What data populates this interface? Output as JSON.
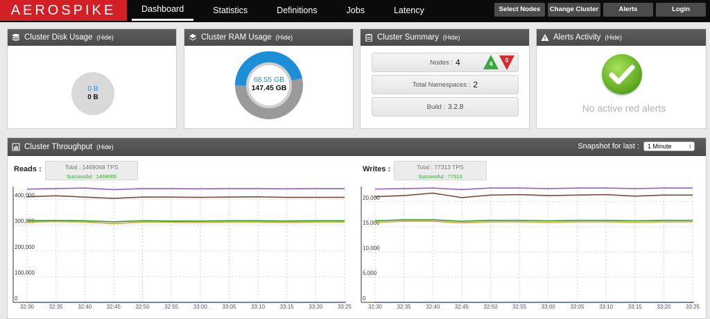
{
  "app": {
    "logo": "AEROSPIKE"
  },
  "nav": {
    "items": [
      {
        "label": "Dashboard",
        "active": true
      },
      {
        "label": "Statistics"
      },
      {
        "label": "Definitions"
      },
      {
        "label": "Jobs"
      },
      {
        "label": "Latency"
      }
    ],
    "buttons": [
      "Select Nodes",
      "Change Cluster",
      "Alerts",
      "Login"
    ]
  },
  "disk": {
    "title": "Cluster Disk Usage",
    "hide": "(Hide)",
    "used": "0 B",
    "total": "0 B"
  },
  "ram": {
    "title": "Cluster RAM Usage",
    "hide": "(Hide)",
    "used": "68.55 GB",
    "total": "147.45 GB",
    "used_fraction": 0.465,
    "colors": {
      "used": "#1c8fd7",
      "free": "#9a9a9a"
    }
  },
  "summary": {
    "title": "Cluster Summary",
    "hide": "(Hide)",
    "nodes_label": "Nodes :",
    "nodes_value": "4",
    "nodes_up": "4",
    "nodes_down": "0",
    "ns_label": "Total Namespaces :",
    "ns_value": "2",
    "build_label": "Build :",
    "build_value": "3.2.8"
  },
  "alerts": {
    "title": "Alerts Activity",
    "hide": "(Hide)",
    "message": "No active red alerts"
  },
  "throughput": {
    "title": "Cluster Throughput",
    "hide": "(Hide)",
    "snapshot_label": "Snapshot for last :",
    "snapshot_value": "1 Minute",
    "reads": {
      "label": "Reads :",
      "total": "Total : 1469068 TPS",
      "successful": "Successful : 1469065"
    },
    "writes": {
      "label": "Writes :",
      "total": "Total : 77313 TPS",
      "successful": "Successful : 77313"
    }
  },
  "chart_data": [
    {
      "type": "line",
      "title": "Reads",
      "x": [
        "32:30",
        "32:35",
        "32:40",
        "32:45",
        "32:50",
        "32:55",
        "33:00",
        "33:05",
        "33:10",
        "33:15",
        "33:20",
        "33:25"
      ],
      "ylim": [
        0,
        450000
      ],
      "yticks": [
        0,
        100000,
        200000,
        300000,
        400000
      ],
      "ytick_labels": [
        "0",
        "100,000",
        "200,000",
        "300,000",
        "400,000"
      ],
      "series": [
        {
          "color": "#8d5fd3",
          "values": [
            440000,
            442000,
            444000,
            438000,
            442000,
            442000,
            441000,
            442000,
            442000,
            441000,
            442000,
            442000
          ]
        },
        {
          "color": "#7b4a3d",
          "values": [
            410000,
            414000,
            409000,
            404000,
            409000,
            409000,
            408000,
            409000,
            410000,
            408000,
            408000,
            408000
          ]
        },
        {
          "color": "#2ca02c",
          "values": [
            317000,
            318000,
            317000,
            313000,
            317000,
            316000,
            316000,
            317000,
            317000,
            316000,
            317000,
            317000
          ]
        },
        {
          "color": "#e39d2a",
          "values": [
            312000,
            314000,
            312000,
            306000,
            312000,
            312000,
            311000,
            312000,
            312000,
            311000,
            312000,
            312000
          ]
        },
        {
          "color": "#3a5ba8",
          "values": [
            0,
            0,
            0,
            0,
            0,
            0,
            0,
            0,
            0,
            0,
            0,
            0
          ]
        }
      ]
    },
    {
      "type": "line",
      "title": "Writes",
      "x": [
        "32:30",
        "32:35",
        "32:40",
        "32:45",
        "32:50",
        "32:55",
        "33:00",
        "33:05",
        "33:10",
        "33:15",
        "33:20",
        "33:25"
      ],
      "ylim": [
        0,
        23000
      ],
      "yticks": [
        0,
        5000,
        10000,
        15000,
        20000
      ],
      "ytick_labels": [
        "0",
        "5,000",
        "10,000",
        "15,000",
        "20,000"
      ],
      "series": [
        {
          "color": "#8d5fd3",
          "values": [
            22500,
            22600,
            22700,
            22400,
            22700,
            22700,
            22600,
            22700,
            22700,
            22600,
            22700,
            22700
          ]
        },
        {
          "color": "#7b4a3d",
          "values": [
            21000,
            21200,
            21700,
            20800,
            21300,
            21400,
            21200,
            21300,
            21400,
            21100,
            21300,
            21300
          ]
        },
        {
          "color": "#2ca02c",
          "values": [
            16200,
            16400,
            16400,
            16100,
            16300,
            16300,
            16200,
            16300,
            16300,
            16200,
            16300,
            16300
          ]
        },
        {
          "color": "#e39d2a",
          "values": [
            15900,
            16100,
            16100,
            15800,
            16000,
            16000,
            15900,
            16000,
            16000,
            15900,
            16000,
            16000
          ]
        },
        {
          "color": "#3a5ba8",
          "values": [
            0,
            0,
            0,
            0,
            0,
            0,
            0,
            0,
            0,
            0,
            0,
            0
          ]
        }
      ]
    }
  ]
}
